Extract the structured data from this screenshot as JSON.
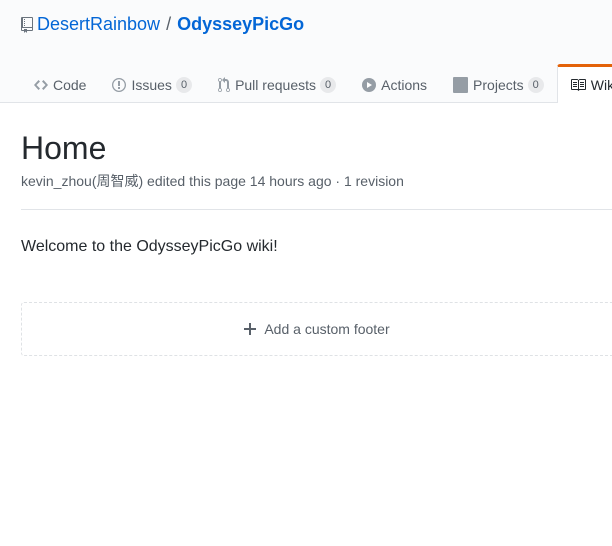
{
  "repo": {
    "owner": "DesertRainbow",
    "separator": "/",
    "name": "OdysseyPicGo"
  },
  "tabs": [
    {
      "label": "Code",
      "icon": "code-icon"
    },
    {
      "label": "Issues",
      "icon": "issue-icon",
      "count": "0"
    },
    {
      "label": "Pull requests",
      "icon": "pull-request-icon",
      "count": "0"
    },
    {
      "label": "Actions",
      "icon": "play-icon"
    },
    {
      "label": "Projects",
      "icon": "project-icon",
      "count": "0"
    },
    {
      "label": "Wiki",
      "icon": "book-icon",
      "selected": true
    }
  ],
  "page": {
    "title": "Home",
    "meta": "kevin_zhou(周智威) edited this page 14 hours ago · 1 revision",
    "body": "Welcome to the OdysseyPicGo wiki!",
    "footer_label": "Add a custom footer"
  },
  "colors": {
    "link": "#0366d6",
    "accent": "#e36209",
    "muted": "#586069"
  }
}
